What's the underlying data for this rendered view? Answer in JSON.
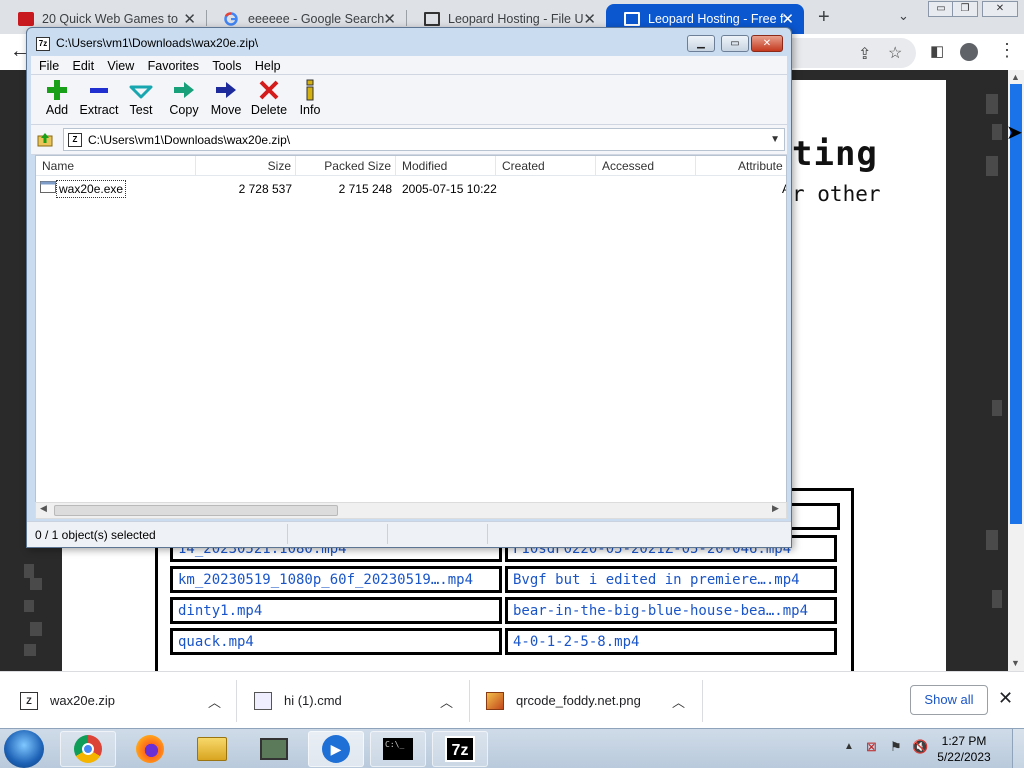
{
  "browser": {
    "tabs": [
      {
        "label": "20 Quick Web Games to",
        "active": false
      },
      {
        "label": "eeeeee - Google Search",
        "active": false
      },
      {
        "label": "Leopard Hosting - File U",
        "active": false
      },
      {
        "label": "Leopard Hosting - Free f",
        "active": true
      }
    ],
    "tab_close": "✕",
    "new_tab": "+",
    "tab_search": "⌄",
    "window_controls": [
      "▭",
      "❐",
      "✕"
    ]
  },
  "page": {
    "title_fragment": "ting",
    "subtitle_fragment": "r other",
    "files": [
      [
        "km_20230519_1080p_60f_20230519….mp4",
        "Bvgf but i edited in premiere….mp4"
      ],
      [
        "dinty1.mp4",
        "bear-in-the-big-blue-house-bea….mp4"
      ],
      [
        "quack.mp4",
        "4-0-1-2-5-8.mp4"
      ]
    ],
    "partial_row": [
      "14_20230521.1080.mp4",
      "F10sdF0220-05-2021Z-05-20-046.mp4"
    ]
  },
  "sevenzip": {
    "title": "C:\\Users\\vm1\\Downloads\\wax20e.zip\\",
    "menu": [
      "File",
      "Edit",
      "View",
      "Favorites",
      "Tools",
      "Help"
    ],
    "tools": [
      {
        "label": "Add",
        "icon": "add-icon",
        "color": "#18a018"
      },
      {
        "label": "Extract",
        "icon": "extract-icon",
        "color": "#1f2fd0"
      },
      {
        "label": "Test",
        "icon": "test-icon",
        "color": "#18a7b0"
      },
      {
        "label": "Copy",
        "icon": "copy-icon",
        "color": "#18a07a"
      },
      {
        "label": "Move",
        "icon": "move-icon",
        "color": "#1c2a9c"
      },
      {
        "label": "Delete",
        "icon": "delete-icon",
        "color": "#d41c1c"
      },
      {
        "label": "Info",
        "icon": "info-icon",
        "color": "#d4b010"
      }
    ],
    "address": "C:\\Users\\vm1\\Downloads\\wax20e.zip\\",
    "columns": [
      "Name",
      "Size",
      "Packed Size",
      "Modified",
      "Created",
      "Accessed",
      "Attribute"
    ],
    "rows": [
      {
        "name": "wax20e.exe",
        "size": "2 728 537",
        "packed": "2 715 248",
        "modified": "2005-07-15 10:22",
        "created": "",
        "accessed": "",
        "attr": "A"
      }
    ],
    "status": "0 / 1 object(s) selected"
  },
  "downloads": {
    "items": [
      {
        "name": "wax20e.zip",
        "icon": "zip-icon"
      },
      {
        "name": "hi (1).cmd",
        "icon": "cmd-icon"
      },
      {
        "name": "qrcode_foddy.net.png",
        "icon": "image-icon"
      }
    ],
    "show_all": "Show all",
    "close": "✕"
  },
  "taskbar": {
    "apps": [
      "chrome-icon",
      "firefox-icon",
      "explorer-icon",
      "network-icon",
      "media-player-icon",
      "cmd-icon",
      "7zip-icon"
    ],
    "time": "1:27 PM",
    "date": "5/22/2023",
    "cmd_glyph": "C:\\_",
    "sevenzip_glyph": "7z"
  }
}
